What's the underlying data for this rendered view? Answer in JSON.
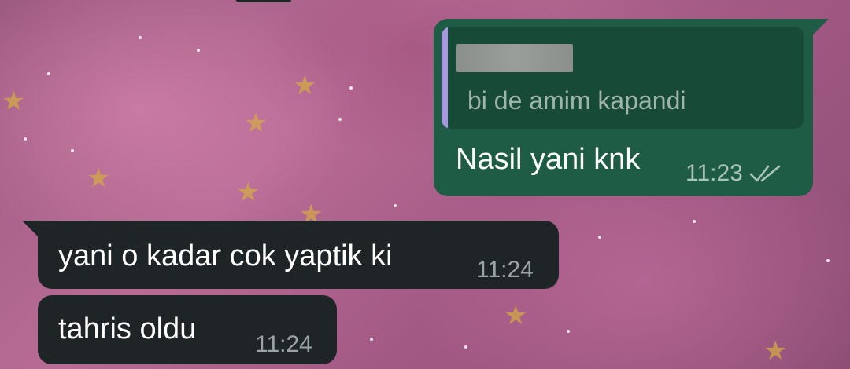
{
  "chat": {
    "outgoing": {
      "quote": {
        "author": "",
        "text": "bi de amim kapandi"
      },
      "text": "Nasil yani knk",
      "time": "11:23",
      "status_icon": "double-check-icon"
    },
    "incoming": [
      {
        "text": "yani o kadar cok yaptik ki",
        "time": "11:24"
      },
      {
        "text": "tahris oldu",
        "time": "11:24"
      }
    ]
  },
  "colors": {
    "outgoing_bubble": "#1f5c45",
    "quote_background": "#174a37",
    "quote_bar": "#a996e0",
    "incoming_bubble": "#1f2527",
    "wallpaper": "#b86c95"
  }
}
